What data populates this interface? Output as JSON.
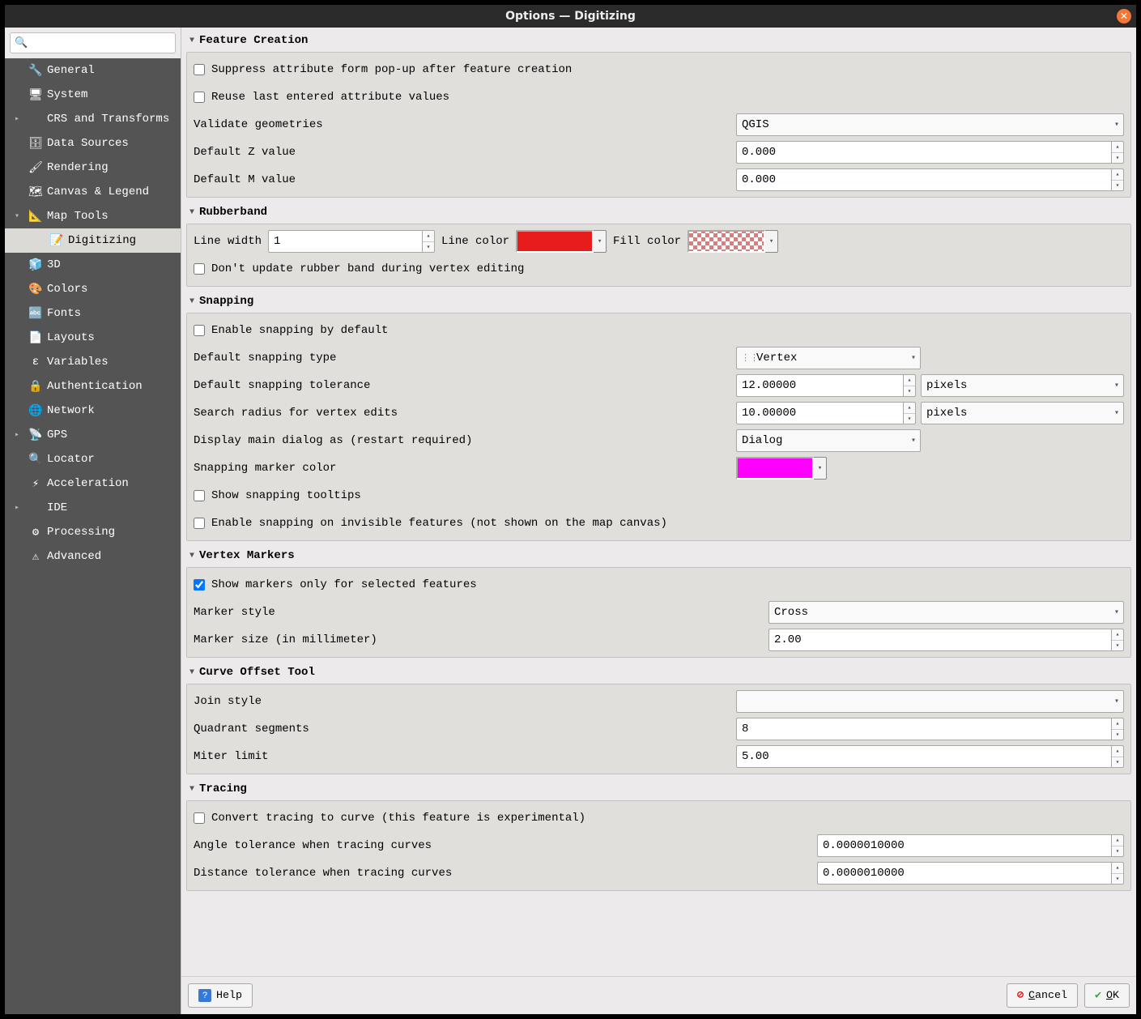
{
  "window": {
    "title": "Options — Digitizing"
  },
  "sidebar": {
    "search_placeholder": "",
    "items": [
      {
        "label": "General",
        "icon": "🔧",
        "expand": ""
      },
      {
        "label": "System",
        "icon": "🖥",
        "expand": ""
      },
      {
        "label": "CRS and Transforms",
        "icon": "",
        "expand": "▸"
      },
      {
        "label": "Data Sources",
        "icon": "🗄",
        "expand": ""
      },
      {
        "label": "Rendering",
        "icon": "🖌",
        "expand": ""
      },
      {
        "label": "Canvas & Legend",
        "icon": "🗺",
        "expand": ""
      },
      {
        "label": "Map Tools",
        "icon": "📐",
        "expand": "▾"
      },
      {
        "label": "Digitizing",
        "icon": "📝",
        "expand": "",
        "child": true,
        "selected": true
      },
      {
        "label": "3D",
        "icon": "🧊",
        "expand": ""
      },
      {
        "label": "Colors",
        "icon": "🎨",
        "expand": ""
      },
      {
        "label": "Fonts",
        "icon": "🔤",
        "expand": ""
      },
      {
        "label": "Layouts",
        "icon": "📄",
        "expand": ""
      },
      {
        "label": "Variables",
        "icon": "ε",
        "expand": ""
      },
      {
        "label": "Authentication",
        "icon": "🔒",
        "expand": ""
      },
      {
        "label": "Network",
        "icon": "🌐",
        "expand": ""
      },
      {
        "label": "GPS",
        "icon": "📡",
        "expand": "▸"
      },
      {
        "label": "Locator",
        "icon": "🔍",
        "expand": ""
      },
      {
        "label": "Acceleration",
        "icon": "⚡",
        "expand": ""
      },
      {
        "label": "IDE",
        "icon": "",
        "expand": "▸"
      },
      {
        "label": "Processing",
        "icon": "⚙",
        "expand": ""
      },
      {
        "label": "Advanced",
        "icon": "⚠",
        "expand": ""
      }
    ]
  },
  "sections": {
    "feature_creation": {
      "title": "Feature Creation",
      "suppress_popup": "Suppress attribute form pop-up after feature creation",
      "reuse_last": "Reuse last entered attribute values",
      "validate_label": "Validate geometries",
      "validate_value": "QGIS",
      "default_z_label": "Default Z value",
      "default_z_value": "0.000",
      "default_m_label": "Default M value",
      "default_m_value": "0.000"
    },
    "rubberband": {
      "title": "Rubberband",
      "line_width_label": "Line width",
      "line_width_value": "1",
      "line_color_label": "Line color",
      "fill_color_label": "Fill color",
      "dont_update": "Don't update rubber band during vertex editing"
    },
    "snapping": {
      "title": "Snapping",
      "enable_default": "Enable snapping by default",
      "type_label": "Default snapping type",
      "type_value": "Vertex",
      "tolerance_label": "Default snapping tolerance",
      "tolerance_value": "12.00000",
      "tolerance_unit": "pixels",
      "search_label": "Search radius for vertex edits",
      "search_value": "10.00000",
      "search_unit": "pixels",
      "display_label": "Display main dialog as (restart required)",
      "display_value": "Dialog",
      "marker_color_label": "Snapping marker color",
      "show_tooltips": "Show snapping tooltips",
      "enable_invisible": "Enable snapping on invisible features (not shown on the map canvas)"
    },
    "vertex_markers": {
      "title": "Vertex Markers",
      "show_selected": "Show markers only for selected features",
      "style_label": "Marker style",
      "style_value": "Cross",
      "size_label": "Marker size (in millimeter)",
      "size_value": "2.00"
    },
    "curve_offset": {
      "title": "Curve Offset Tool",
      "join_label": "Join style",
      "join_value": "",
      "quadrant_label": "Quadrant segments",
      "quadrant_value": "8",
      "miter_label": "Miter limit",
      "miter_value": "5.00"
    },
    "tracing": {
      "title": "Tracing",
      "convert_curve": "Convert tracing to curve (this feature is experimental)",
      "angle_label": "Angle tolerance when tracing curves",
      "angle_value": "0.0000010000",
      "distance_label": "Distance tolerance when tracing curves",
      "distance_value": "0.0000010000"
    }
  },
  "footer": {
    "help": "Help",
    "cancel": "Cancel",
    "ok": "OK"
  }
}
